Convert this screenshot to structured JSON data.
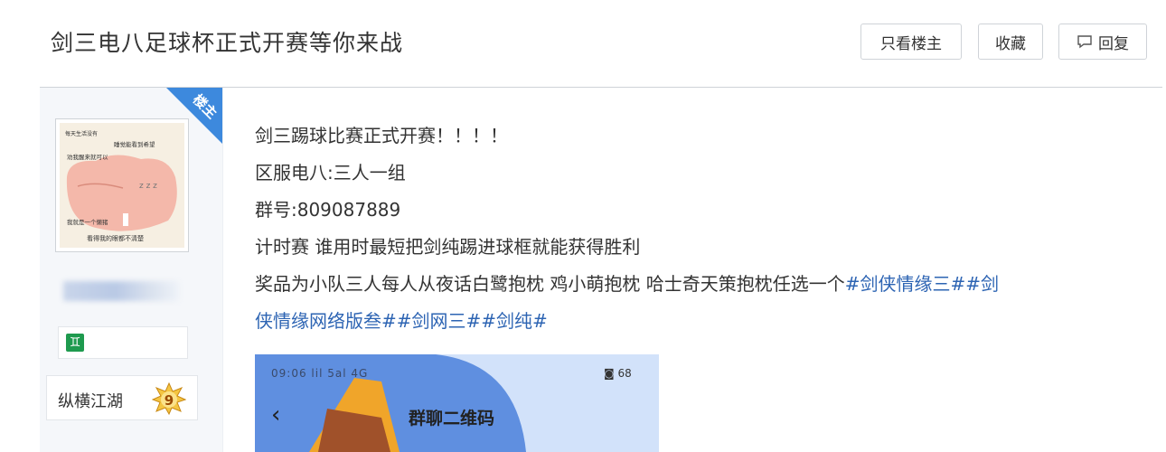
{
  "header": {
    "title": "剑三电八足球杯正式开赛等你来战",
    "buttons": {
      "host_only": "只看楼主",
      "favorite": "收藏",
      "reply": "回复"
    }
  },
  "author": {
    "badge": "楼主",
    "level_title": "纵横江湖",
    "level_number": "9",
    "avatar_texts": [
      "每天生活没有",
      "睡觉能看到希望",
      "劝我醒来就可以",
      "我就是一个懒猪",
      "看得我的眼都不清楚"
    ]
  },
  "post": {
    "lines": [
      "剑三踢球比赛正式开赛！！！！",
      "区服电八:三人一组",
      "群号:809087889",
      "计时赛 谁用时最短把剑纯踢进球框就能获得胜利"
    ],
    "line5_text": "奖品为小队三人每人从夜话白鹭抱枕 鸡小萌抱枕 哈士奇天策抱枕任选一个",
    "line5_tags": "#剑侠情缘三##剑",
    "line6_tags": "侠情缘网络版叁##剑网三##剑纯#"
  },
  "embedded_screenshot": {
    "status_left": "09:06 lil 5al 4G",
    "status_right": "◙ 68",
    "back_glyph": "‹",
    "title": "群聊二维码"
  },
  "colors": {
    "accent": "#3d89dd",
    "link": "#2d64b3",
    "sidebar_bg": "#f5f7fa"
  },
  "icons": {
    "reply": "comment-icon",
    "sign": "gemini-sign-icon",
    "level": "level-star-icon"
  }
}
